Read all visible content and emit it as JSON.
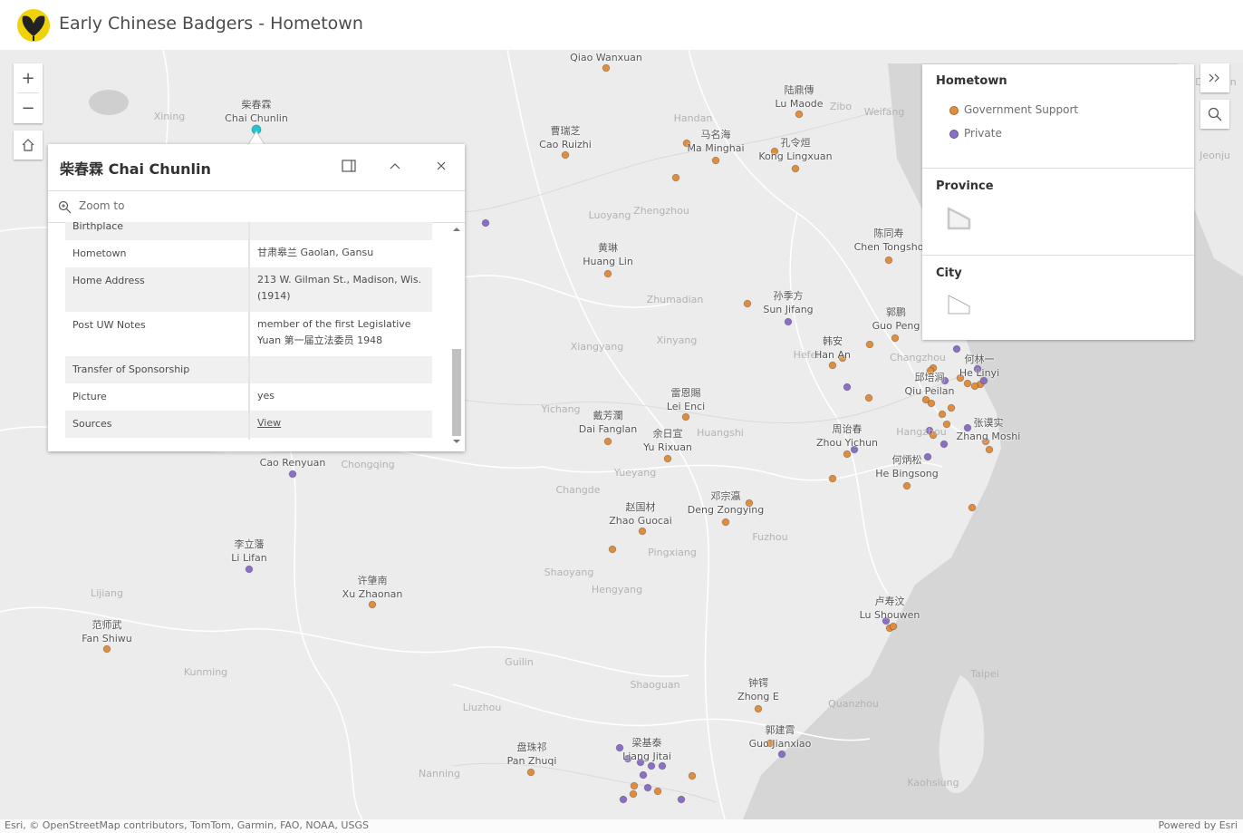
{
  "header": {
    "title": "Early Chinese Badgers - Hometown"
  },
  "colors": {
    "government": "#e08e3c",
    "private": "#8b6fc6",
    "highlight": "#20c6d8",
    "logo": "#f0d20a"
  },
  "zoom": {
    "in": "+",
    "out": "−"
  },
  "popup": {
    "title": "柴春霖 Chai Chunlin",
    "zoom_to": "Zoom to",
    "rows": [
      {
        "key": "Birthplace",
        "value": ""
      },
      {
        "key": "Hometown",
        "value": "甘肃皋兰 Gaolan, Gansu"
      },
      {
        "key": "Home Address",
        "value": "213 W. Gilman St., Madison, Wis. (1914)"
      },
      {
        "key": "Post UW Notes",
        "value": "member of the first Legislative Yuan 第一届立法委员 1948"
      },
      {
        "key": "Transfer of Sponsorship",
        "value": ""
      },
      {
        "key": "Picture",
        "value": "yes"
      },
      {
        "key": "Sources",
        "value": "View"
      }
    ]
  },
  "legend": {
    "hometown_title": "Hometown",
    "items": [
      {
        "label": "Government Support",
        "color": "#e08e3c"
      },
      {
        "label": "Private",
        "color": "#8b6fc6"
      }
    ],
    "province_title": "Province",
    "city_title": "City"
  },
  "places": [
    {
      "cn": "",
      "en": "Qiao Wanxuan"
    },
    {
      "cn": "柴春霖",
      "en": "Chai Chunlin"
    },
    {
      "cn": "陆鼎傳",
      "en": "Lu Maode"
    },
    {
      "cn": "曹瑞芝",
      "en": "Cao Ruizhi"
    },
    {
      "cn": "马名海",
      "en": "Ma Minghai"
    },
    {
      "cn": "孔令烜",
      "en": "Kong Lingxuan"
    },
    {
      "cn": "陈同寿",
      "en": "Chen Tongsho"
    },
    {
      "cn": "黄琳",
      "en": "Huang Lin"
    },
    {
      "cn": "孙季方",
      "en": "Sun Jifang"
    },
    {
      "cn": "郭鹏",
      "en": "Guo Peng"
    },
    {
      "cn": "韩安",
      "en": "Han An"
    },
    {
      "cn": "何林一",
      "en": "He Linyi"
    },
    {
      "cn": "邱培涧",
      "en": "Qiu Peilan"
    },
    {
      "cn": "雷恩賜",
      "en": "Lei Enci"
    },
    {
      "cn": "戴芳瀾",
      "en": "Dai Fanglan"
    },
    {
      "cn": "余日宣",
      "en": "Yu Rixuan"
    },
    {
      "cn": "周诒春",
      "en": "Zhou Yichun"
    },
    {
      "cn": "张谟实",
      "en": "Zhang Moshi"
    },
    {
      "cn": "何炳松",
      "en": "He Bingsong"
    },
    {
      "cn": "",
      "en": "Cao Renyuan"
    },
    {
      "cn": "赵国材",
      "en": "Zhao Guocai"
    },
    {
      "cn": "邓宗瀛",
      "en": "Deng Zongying"
    },
    {
      "cn": "李立藩",
      "en": "Li Lifan"
    },
    {
      "cn": "许肇南",
      "en": "Xu Zhaonan"
    },
    {
      "cn": "卢寿汶",
      "en": "Lu Shouwen"
    },
    {
      "cn": "范师武",
      "en": "Fan Shiwu"
    },
    {
      "cn": "钟锷",
      "en": "Zhong E"
    },
    {
      "cn": "郭建霄",
      "en": "Guo Jianxiao"
    },
    {
      "cn": "盘珠祁",
      "en": "Pan Zhuqi"
    },
    {
      "cn": "梁基泰",
      "en": "Liang Jitai"
    }
  ],
  "basemap_labels": [
    "Xining",
    "Luoyang",
    "Zhengzhou",
    "Handan",
    "Weifang",
    "Zibo",
    "Xiangyang",
    "Xinyang",
    "Zhumadian",
    "Hefei",
    "Changzhou",
    "Hangzhou",
    "Yichang",
    "Huangshi",
    "Chongqing",
    "Changde",
    "Yueyang",
    "Shaoyang",
    "Hengyang",
    "Pingxiang",
    "Fuzhou",
    "Quanzhou",
    "Lijiang",
    "Kunming",
    "Guilin",
    "Liuzhou",
    "Shaoguan",
    "Nanning",
    "Taipei",
    "Kaohsiung",
    "Jeonju",
    "Daejeon"
  ],
  "footer": {
    "attribution": "Esri, © OpenStreetMap contributors, TomTom, Garmin, FAO, NOAA, USGS",
    "powered": "Powered by Esri"
  }
}
